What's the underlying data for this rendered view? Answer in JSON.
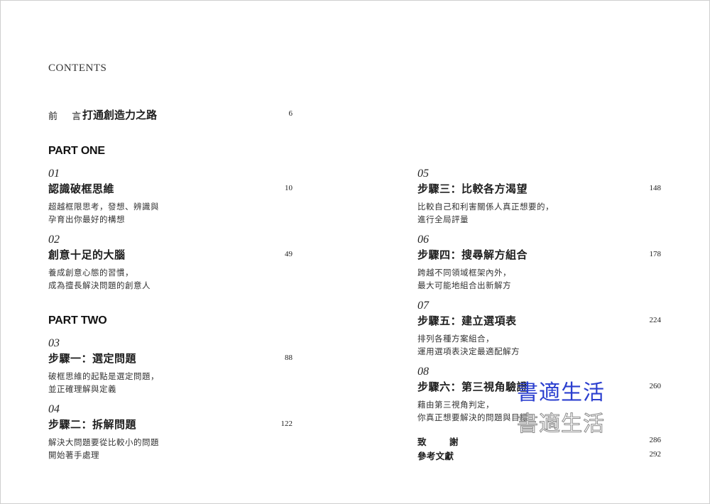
{
  "header": {
    "contents_label": "CONTENTS"
  },
  "preface": {
    "label": "前 言",
    "title": "打通創造力之路",
    "page": "6"
  },
  "parts": [
    {
      "label": "PART ONE"
    },
    {
      "label": "PART TWO"
    }
  ],
  "chapters": [
    {
      "num": "01",
      "title": "認識破框思維",
      "page": "10",
      "desc_line1": "超越框限思考，發想、辨識與",
      "desc_line2": "孕育出你最好的構想"
    },
    {
      "num": "02",
      "title": "創意十足的大腦",
      "page": "49",
      "desc_line1": "養成創意心態的習慣，",
      "desc_line2": "成為擅長解決問題的創意人"
    },
    {
      "num": "03",
      "title": "步驟一：選定問題",
      "page": "88",
      "desc_line1": "破框思維的起點是選定問題，",
      "desc_line2": "並正確理解與定義"
    },
    {
      "num": "04",
      "title": "步驟二：拆解問題",
      "page": "122",
      "desc_line1": "解決大問題要從比較小的問題",
      "desc_line2": "開始著手處理"
    },
    {
      "num": "05",
      "title": "步驟三：比較各方渴望",
      "page": "148",
      "desc_line1": "比較自己和利害關係人真正想要的，",
      "desc_line2": "進行全局評量"
    },
    {
      "num": "06",
      "title": "步驟四：搜尋解方組合",
      "page": "178",
      "desc_line1": "跨越不同領域框架內外，",
      "desc_line2": "最大可能地組合出新解方"
    },
    {
      "num": "07",
      "title": "步驟五：建立選項表",
      "page": "224",
      "desc_line1": "排列各種方案組合，",
      "desc_line2": "運用選項表決定最適配解方"
    },
    {
      "num": "08",
      "title": "步驟六：第三視角驗證",
      "page": "260",
      "desc_line1": "藉由第三視角判定，",
      "desc_line2": "你真正想要解決的問題與目標"
    }
  ],
  "back_matter": [
    {
      "label": "致 謝",
      "page": "286"
    },
    {
      "label": "參考文獻",
      "page": "292"
    }
  ],
  "watermark": {
    "text": "書適生活",
    "colors": [
      "#2b3fcf",
      "#8a8a8a"
    ]
  }
}
